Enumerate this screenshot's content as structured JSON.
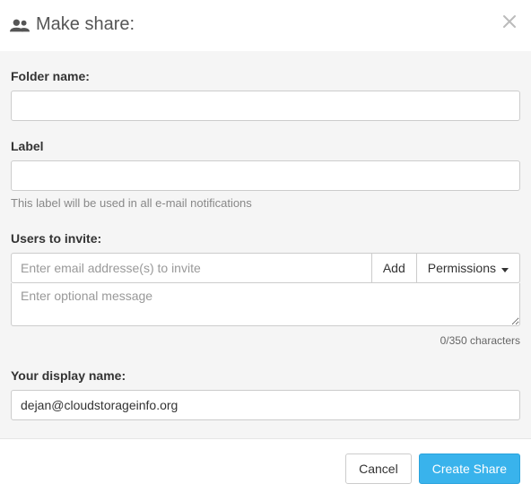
{
  "header": {
    "title": "Make share:"
  },
  "folder_name": {
    "label": "Folder name:",
    "value": ""
  },
  "label_field": {
    "label": "Label",
    "value": "",
    "helper": "This label will be used in all e-mail notifications"
  },
  "invite": {
    "label": "Users to invite:",
    "email_placeholder": "Enter email addresse(s) to invite",
    "add_label": "Add",
    "permissions_label": "Permissions",
    "message_placeholder": "Enter optional message",
    "char_count": "0/350 characters"
  },
  "display_name": {
    "label": "Your display name:",
    "value": "dejan@cloudstorageinfo.org"
  },
  "footer": {
    "cancel_label": "Cancel",
    "create_label": "Create Share"
  }
}
